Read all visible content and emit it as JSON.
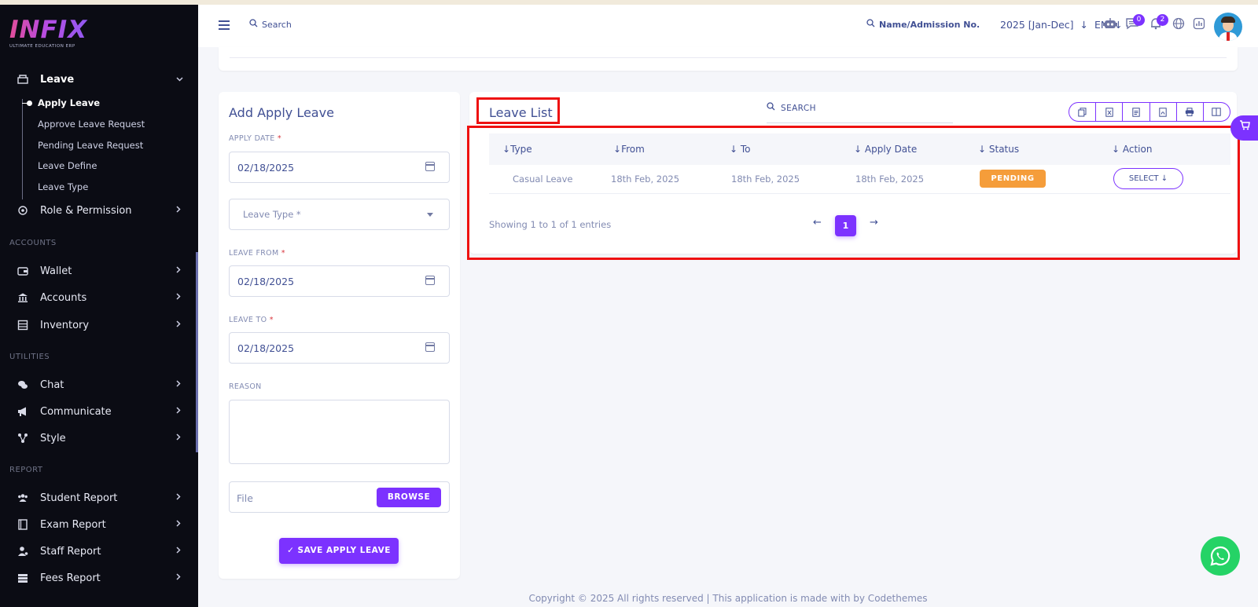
{
  "brand": {
    "name": "INFIX",
    "tagline": "ULTIMATE EDUCATION ERP"
  },
  "sidebar": {
    "leave": {
      "label": "Leave",
      "icon": "leave-icon"
    },
    "leave_sub": [
      "Apply Leave",
      "Approve Leave Request",
      "Pending Leave Request",
      "Leave Define",
      "Leave Type"
    ],
    "role": {
      "label": "Role & Permission",
      "icon": "role-icon"
    },
    "sections": {
      "accounts": "ACCOUNTS",
      "utilities": "UTILITIES",
      "report": "REPORT"
    },
    "accounts_items": [
      {
        "label": "Wallet",
        "icon": "wallet-icon"
      },
      {
        "label": "Accounts",
        "icon": "bank-icon"
      },
      {
        "label": "Inventory",
        "icon": "inventory-icon"
      }
    ],
    "utilities_items": [
      {
        "label": "Chat",
        "icon": "chat-icon"
      },
      {
        "label": "Communicate",
        "icon": "megaphone-icon"
      },
      {
        "label": "Style",
        "icon": "style-icon"
      }
    ],
    "report_items": [
      {
        "label": "Student Report",
        "icon": "students-icon"
      },
      {
        "label": "Exam Report",
        "icon": "exam-icon"
      },
      {
        "label": "Staff Report",
        "icon": "staff-icon"
      },
      {
        "label": "Fees Report",
        "icon": "fees-icon"
      }
    ]
  },
  "header": {
    "search_label": "Search",
    "student_search_label": "Name/Admission No.",
    "academic_year": "2025 [Jan-Dec]",
    "language": "EN",
    "chat_count": "0",
    "notification_count": "2"
  },
  "form": {
    "title": "Add Apply Leave",
    "apply_date_label": "APPLY DATE",
    "apply_date_value": "02/18/2025",
    "leave_type_placeholder": "Leave Type *",
    "leave_from_label": "LEAVE FROM",
    "leave_from_value": "02/18/2025",
    "leave_to_label": "LEAVE TO",
    "leave_to_value": "02/18/2025",
    "reason_label": "REASON",
    "file_placeholder": "File",
    "browse_label": "BROWSE",
    "save_label": "✓ SAVE APPLY LEAVE",
    "required_mark": "*"
  },
  "list": {
    "title": "Leave List",
    "search_label": "SEARCH",
    "columns": [
      "Type",
      "From",
      "To",
      "Apply Date",
      "Status",
      "Action"
    ],
    "rows": [
      {
        "type": "Casual Leave",
        "from": "18th Feb, 2025",
        "to": "18th Feb, 2025",
        "apply_date": "18th Feb, 2025",
        "status": "PENDING",
        "action": "SELECT"
      }
    ],
    "showing": "Showing 1 to 1 of 1 entries",
    "current_page": "1"
  },
  "footer": "Copyright © 2025 All rights reserved | This application is made with by Codethemes",
  "colors": {
    "accent": "#7c32ff",
    "sidebar_bg": "#0b0c14",
    "text": "#415094",
    "pending": "#f59d3a",
    "highlight": "#ee1111",
    "whatsapp": "#25d366"
  }
}
